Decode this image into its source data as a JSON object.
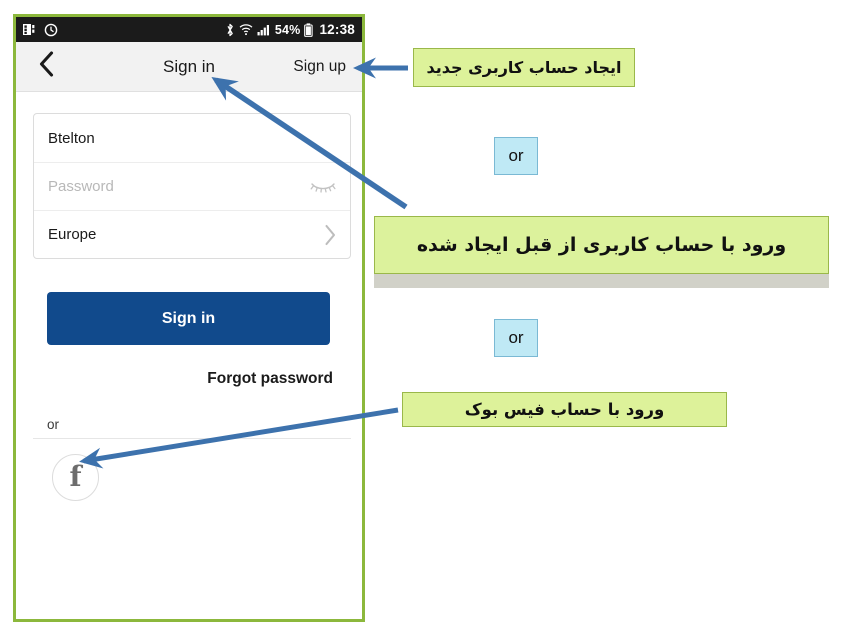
{
  "status_bar": {
    "icons_left": [
      "contacts-icon",
      "alarm-icon"
    ],
    "icons_right": [
      "bluetooth-icon",
      "wifi-icon",
      "signal-icon"
    ],
    "battery_percent": "54%",
    "battery_icon": "battery-icon",
    "clock": "12:38"
  },
  "nav_bar": {
    "back_icon": "back-chevron-icon",
    "title": "Sign in",
    "signup_label": "Sign up"
  },
  "form": {
    "fields": [
      {
        "name": "username",
        "value": "Btelton",
        "is_placeholder": false,
        "right_icon": ""
      },
      {
        "name": "password",
        "value": "Password",
        "is_placeholder": true,
        "right_icon": "eye-closed-icon"
      },
      {
        "name": "region",
        "value": "Europe",
        "is_placeholder": false,
        "right_icon": "chevron-right-icon"
      }
    ]
  },
  "actions": {
    "signin_button_label": "Sign in",
    "signin_button_color": "#114a8c",
    "forgot_password_label": "Forgot password",
    "or_label": "or",
    "facebook_glyph": "f"
  },
  "annotations": {
    "callout_signup": "ایجاد حساب کاربری جدید",
    "callout_signin": "ورود با حساب کاربری از قبل ایجاد شده",
    "callout_facebook": "ورود با حساب فیس بوک",
    "or_box_1": "or",
    "or_box_2": "or",
    "callout_fill": "#ddf29a",
    "callout_border": "#9ab84a",
    "or_box_fill": "#bfe9f5",
    "or_box_border": "#7ab9d4",
    "arrow_color": "#3d72ad",
    "frame_color": "#8cb83c"
  }
}
